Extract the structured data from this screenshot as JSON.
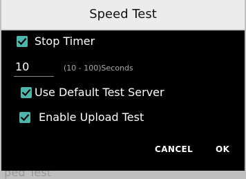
{
  "background": {
    "label": "ped Test"
  },
  "dialog": {
    "title": "Speed Test",
    "stop_timer": {
      "label": "Stop Timer",
      "checked": true
    },
    "timer": {
      "value": "10",
      "hint": "(10 - 100)Seconds"
    },
    "default_server": {
      "label": "Use Default Test Server",
      "checked": true
    },
    "upload_test": {
      "label": "Enable Upload Test",
      "checked": true
    },
    "buttons": {
      "cancel": "CANCEL",
      "ok": "OK"
    }
  },
  "colors": {
    "accent": "#4db6ac",
    "dialog_background": "#000000",
    "title_background": "#ececec"
  }
}
